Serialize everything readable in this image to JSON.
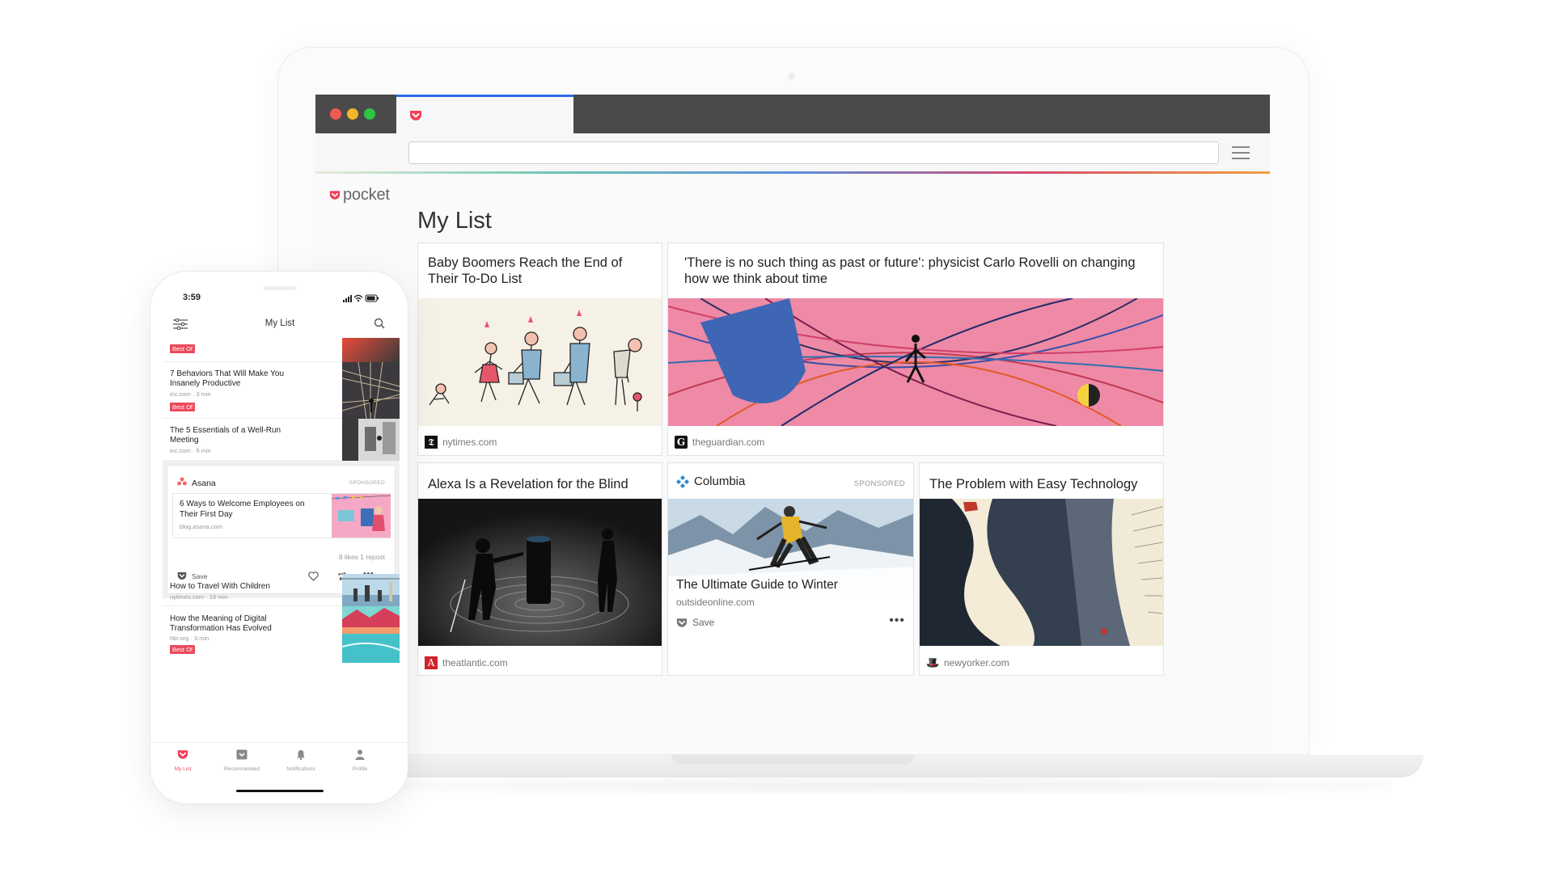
{
  "colors": {
    "brand": "#ef4056",
    "accent_tab": "#2d6be5",
    "badge": "#ea4b5c"
  },
  "browser": {
    "traffic_lights": [
      "close",
      "minimize",
      "maximize"
    ],
    "tab_icon": "pocket-icon",
    "menu_icon": "hamburger-icon"
  },
  "site": {
    "logo_text": "pocket",
    "page_title": "My List"
  },
  "cards": [
    {
      "title": "Baby Boomers Reach the End of Their To-Do List",
      "source": "nytimes.com",
      "source_icon": "nyt-icon"
    },
    {
      "title": "'There is no such thing as past or future': physicist Carlo Rovelli on changing how we think about time",
      "source": "theguardian.com",
      "source_icon": "guardian-icon"
    },
    {
      "title": "Alexa Is a Revelation for the Blind",
      "source": "theatlantic.com",
      "source_icon": "atlantic-icon"
    },
    {
      "brand": "Columbia",
      "tag": "SPONSORED",
      "title": "The Ultimate Guide to Winter",
      "source": "outsideonline.com",
      "save_label": "Save",
      "more_icon": "more-dots-icon"
    },
    {
      "title": "The Problem with Easy Technology",
      "source": "newyorker.com",
      "source_icon": "newyorker-icon"
    }
  ],
  "phone": {
    "time": "3:59",
    "header_title": "My List",
    "best_of_label": "Best Of",
    "items": [
      {
        "title": "7 Behaviors That Will Make You Insanely Productive",
        "meta": "inc.com · 3 min"
      },
      {
        "title": "The 5 Essentials of a Well-Run Meeting",
        "meta": "inc.com · 5 min"
      },
      {
        "title": "How to Travel With Children",
        "meta": "nytimes.com · 19 min"
      },
      {
        "title": "How the Meaning of Digital Transformation Has Evolved",
        "meta": "hbr.org · 3 min"
      }
    ],
    "sponsored": {
      "brand": "Asana",
      "tag": "SPONSORED",
      "title": "6 Ways to Welcome Employees on Their First Day",
      "url": "blog.asana.com",
      "stats": "8 likes  1 repost",
      "save_label": "Save"
    },
    "tabs": [
      "My List",
      "Recommended",
      "Notifications",
      "Profile"
    ]
  }
}
